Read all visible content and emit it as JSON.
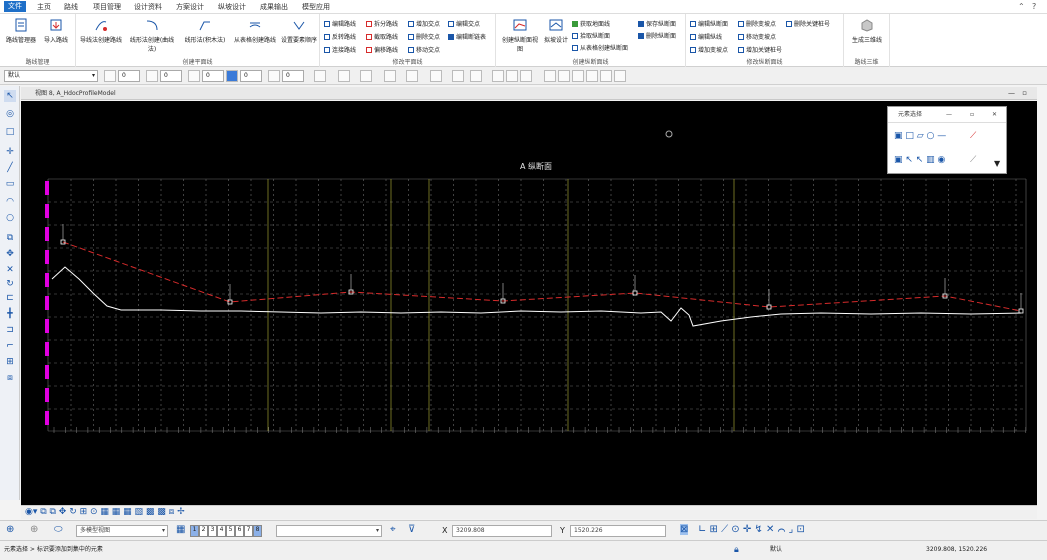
{
  "menu": {
    "tabs": [
      "文件",
      "主页",
      "路线",
      "项目管理",
      "设计资料",
      "方案设计",
      "纵坡设计",
      "成果输出",
      "模型应用"
    ]
  },
  "ribbon": {
    "group_route_manage": {
      "title": "路线管理",
      "btn_route_manager": "路线管理器",
      "btn_import_route": "导入路线"
    },
    "group_create_plan": {
      "title": "创建平面线",
      "btn_tangent": "导线法创建路线",
      "btn_curve1": "线形法创建(曲线法)",
      "btn_curve2": "线形法(积木法)",
      "btn_from_table": "从表格创建路线",
      "btn_set_order": "设置要素顺序"
    },
    "group_modify_plan": {
      "title": "修改平面线",
      "items": [
        "编辑路线",
        "拆分路线",
        "增加交点",
        "编辑交点",
        "反转路线",
        "截取路线",
        "删除交点",
        "编辑断链表",
        "连接路线",
        "偏移路线",
        "移动交点"
      ]
    },
    "group_create_profile": {
      "title": "创建纵断面线",
      "btn_create_profile_view": "创建纵断面视图",
      "btn_fit_design": "拟坡设计",
      "items": [
        "获取地面线",
        "拾取纵断面",
        "从表格创建纵断面",
        "保存纵断面",
        "删除纵断面"
      ]
    },
    "group_modify_profile": {
      "title": "修改纵断面线",
      "items": [
        "编辑纵断面",
        "删除变坡点",
        "删除关键桩号",
        "编辑纵线",
        "移动变坡点",
        "增加变坡点",
        "增加关键桩号"
      ]
    },
    "group_3d": {
      "title": "路线三维",
      "btn_generate_3d": "生成三维线"
    }
  },
  "toolbar": {
    "level_combo": "默认",
    "counts": [
      "0",
      "0",
      "0",
      "0",
      "0"
    ]
  },
  "view": {
    "header_title": "视图 8, A_HdocProfileModel",
    "section_title": "A 纵断面"
  },
  "element_select": {
    "title": "元素选择"
  },
  "bottom": {
    "model_combo": "多模型视图",
    "view_numbers": [
      "1",
      "2",
      "3",
      "4",
      "5",
      "6",
      "7",
      "8"
    ],
    "x_label": "X",
    "x_value": "3209.808",
    "y_label": "Y",
    "y_value": "1520.226"
  },
  "status": {
    "left_text": "元素选择 > 标识要添加到集中的元素",
    "level": "默认",
    "coords": "3209.808, 1520.226"
  },
  "colors": {
    "accent": "#1e6fc8",
    "design_line": "#d62b2b",
    "ground_line": "#ffffff",
    "grid": "#6a6a6a",
    "magenta_marks": "#e000e0",
    "yellow_lines": "#b8b83a"
  }
}
